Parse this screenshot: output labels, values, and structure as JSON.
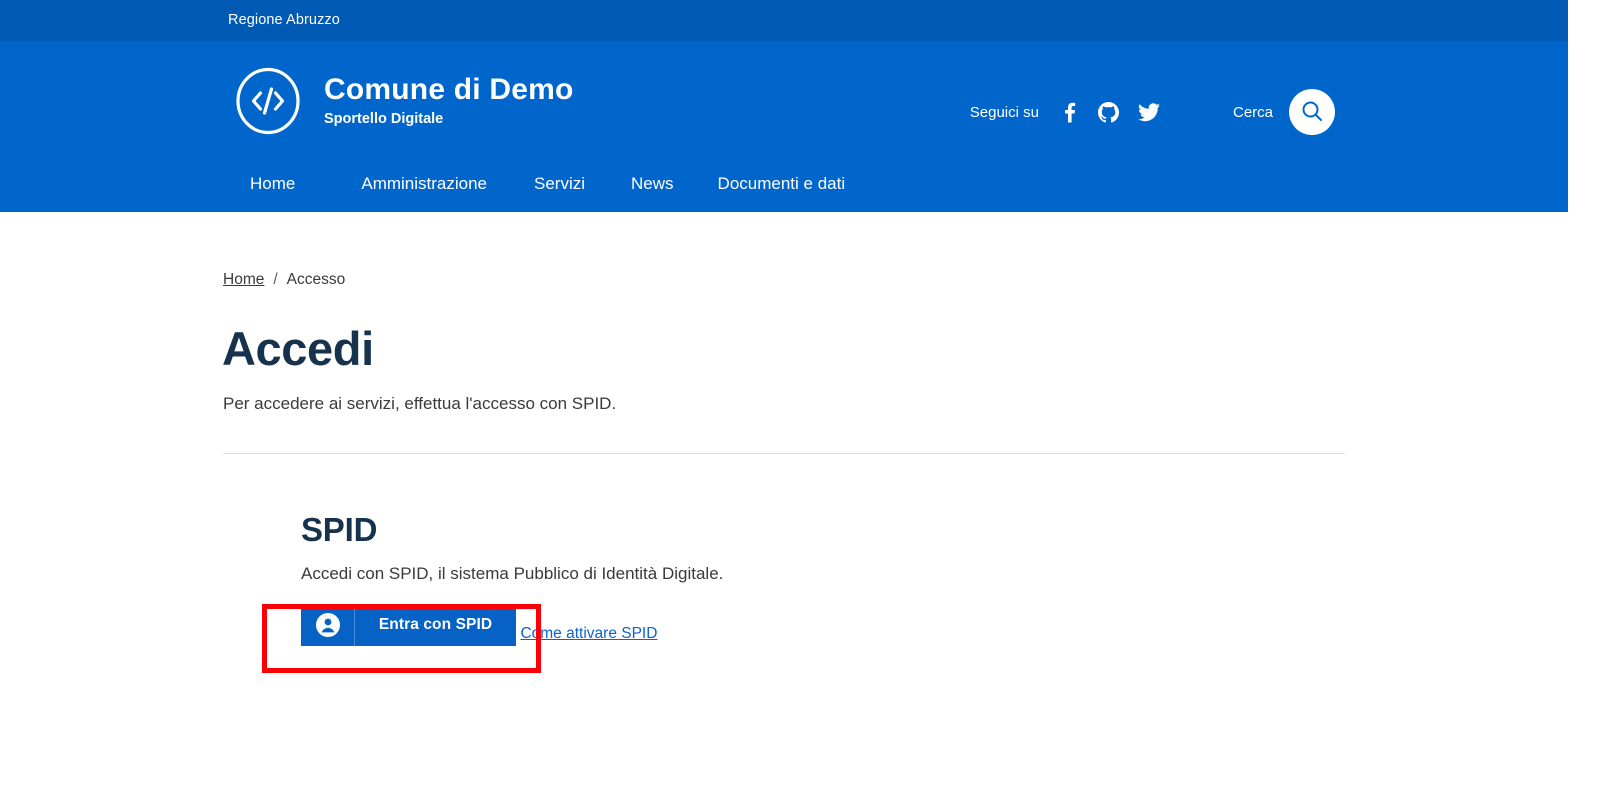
{
  "topbar": {
    "owner_label": "Regione Abruzzo"
  },
  "header": {
    "brand": {
      "logo_icon": "code-brackets-circle-icon",
      "title": "Comune di Demo",
      "subtitle": "Sportello Digitale"
    },
    "follow": {
      "label": "Seguici su",
      "socials": [
        {
          "name": "facebook",
          "icon": "facebook-icon"
        },
        {
          "name": "github",
          "icon": "github-icon"
        },
        {
          "name": "twitter",
          "icon": "twitter-icon"
        }
      ]
    },
    "search": {
      "label": "Cerca",
      "icon": "search-icon"
    },
    "nav": [
      {
        "label": "Home"
      },
      {
        "label": "Amministrazione"
      },
      {
        "label": "Servizi"
      },
      {
        "label": "News"
      },
      {
        "label": "Documenti e dati"
      }
    ]
  },
  "breadcrumb": {
    "home_label": "Home",
    "separator": "/",
    "current_label": "Accesso"
  },
  "main": {
    "title": "Accedi",
    "intro": "Per accedere ai servizi, effettua l'accesso con SPID.",
    "spid": {
      "heading": "SPID",
      "description": "Accedi con SPID, il sistema Pubblico di Identità Digitale.",
      "button_label": "Entra con SPID",
      "button_icon": "user-circle-icon",
      "help_link_label": "Come attivare SPID"
    }
  },
  "colors": {
    "topbar_blue": "#0059b3",
    "header_blue": "#0066cc",
    "spid_button_blue": "#0662c4",
    "link_blue": "#0b63ce",
    "heading_navy": "#17324d",
    "annotation_red": "#fb0007"
  }
}
